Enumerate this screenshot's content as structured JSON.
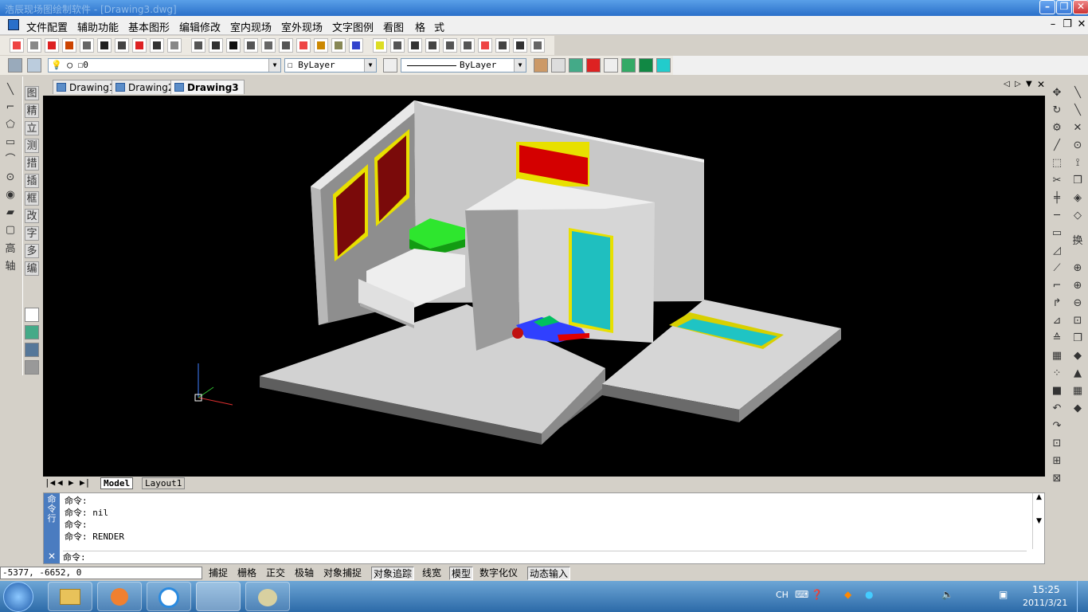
{
  "window": {
    "title": "浩辰现场图绘制软件 - [Drawing3.dwg]"
  },
  "menu": [
    "文件配置",
    "辅助功能",
    "基本图形",
    "编辑修改",
    "室内现场",
    "室外现场",
    "文字图例",
    "看图",
    "格",
    "式"
  ],
  "layer": {
    "current": "0",
    "color": "ByLayer",
    "linetype": "ByLayer"
  },
  "tabs": [
    "Drawing1",
    "Drawing2",
    "Drawing3"
  ],
  "left_panel_labels": [
    "图",
    "精",
    "立",
    "测",
    "措",
    "插",
    "框",
    "改",
    "字",
    "多",
    "编"
  ],
  "left_panel_tools": [
    "高",
    "轴"
  ],
  "right_panel_labels": [
    "换"
  ],
  "layout_tabs": [
    "Model",
    "Layout1"
  ],
  "command": {
    "side_label": "命令行",
    "history": [
      "命令:",
      "命令: nil",
      "命令:",
      "命令: RENDER"
    ],
    "prompt": "命令:"
  },
  "coordinates": "-5377,  -6652,  0",
  "status_buttons": [
    {
      "label": "捕捉",
      "on": false
    },
    {
      "label": "栅格",
      "on": false
    },
    {
      "label": "正交",
      "on": false
    },
    {
      "label": "极轴",
      "on": false
    },
    {
      "label": "对象捕捉",
      "on": false
    },
    {
      "label": "对象追踪",
      "on": true
    },
    {
      "label": "线宽",
      "on": false
    },
    {
      "label": "模型",
      "on": true
    },
    {
      "label": "数字化仪",
      "on": false
    },
    {
      "label": "动态输入",
      "on": true
    }
  ],
  "tray": {
    "lang": "CH",
    "time": "15:25",
    "date": "2011/3/21"
  },
  "colors": {
    "accent": "#2a6fc9",
    "canvas": "#000000"
  }
}
